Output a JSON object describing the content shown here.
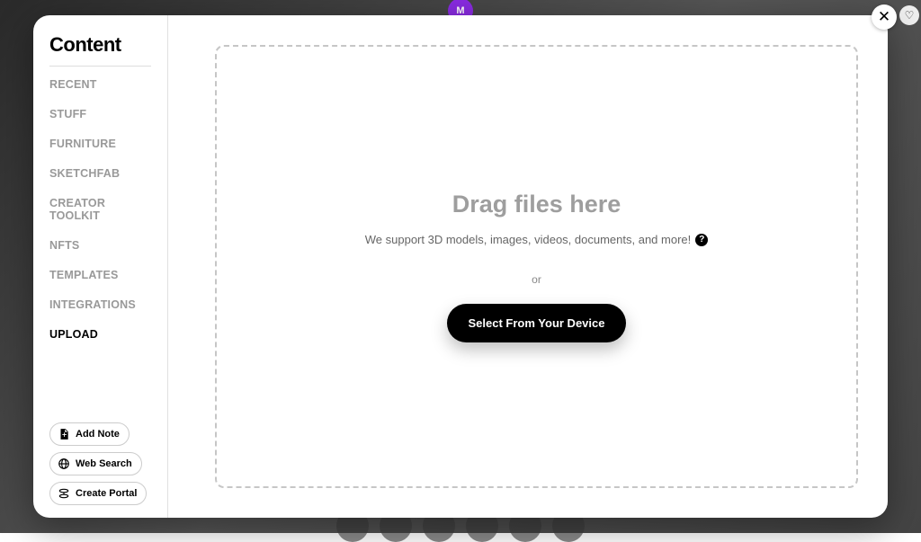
{
  "backdrop_avatar_letter": "M",
  "sidebar": {
    "title": "Content",
    "nav": {
      "recent": "RECENT",
      "stuff": "STUFF",
      "furniture": "FURNITURE",
      "sketchfab": "SKETCHFAB",
      "creator_toolkit": "CREATOR TOOLKIT",
      "nfts": "NFTS",
      "templates": "TEMPLATES",
      "integrations": "INTEGRATIONS",
      "upload": "UPLOAD"
    },
    "actions": {
      "add_note": "Add Note",
      "web_search": "Web Search",
      "create_portal": "Create Portal"
    }
  },
  "upload": {
    "heading": "Drag files here",
    "subtext": "We support 3D models, images, videos, documents, and more!",
    "or": "or",
    "select_btn": "Select From Your Device"
  }
}
